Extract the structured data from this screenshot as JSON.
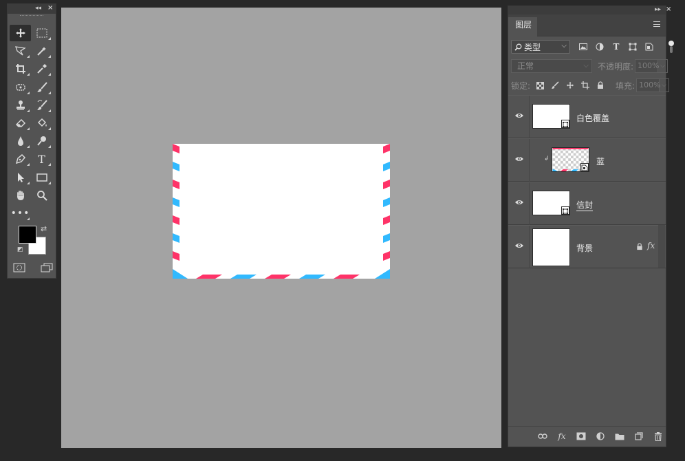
{
  "tools": {
    "rows": [
      [
        "move-tool",
        "marquee-tool"
      ],
      [
        "lasso-tool",
        "quick-select-tool"
      ],
      [
        "crop-tool",
        "eyedropper-tool"
      ],
      [
        "healing-brush-tool",
        "brush-tool"
      ],
      [
        "clone-stamp-tool",
        "history-brush-tool"
      ],
      [
        "eraser-tool",
        "paint-bucket-tool"
      ],
      [
        "blur-tool",
        "dodge-tool"
      ],
      [
        "pen-tool",
        "type-tool"
      ],
      [
        "path-select-tool",
        "rectangle-tool"
      ],
      [
        "hand-tool",
        "zoom-tool"
      ],
      [
        "more-tools",
        ""
      ]
    ],
    "foreground_color": "#000000",
    "background_color": "#ffffff"
  },
  "layers_panel": {
    "tab_label": "图层",
    "filter": {
      "selected": "类型",
      "icons": [
        "image-filter-icon",
        "adjustment-filter-icon",
        "type-filter-icon",
        "shape-filter-icon",
        "smart-object-filter-icon"
      ]
    },
    "blend_mode": "正常",
    "opacity_label": "不透明度:",
    "opacity_value": "100%",
    "lock_label": "锁定:",
    "fill_label": "填充:",
    "fill_value": "100%",
    "layers": [
      {
        "name": "白色覆盖",
        "visible": true,
        "smart_object": true,
        "clipped": false
      },
      {
        "name": "蓝",
        "visible": true,
        "smart_object": true,
        "clipped": true
      },
      {
        "name": "信封",
        "visible": true,
        "smart_object": true,
        "clipped": false
      },
      {
        "name": "背景",
        "visible": true,
        "locked": true,
        "has_fx": true
      }
    ],
    "bottom_icons": [
      "link-layers-icon",
      "fx-icon",
      "mask-icon",
      "adjustment-layer-icon",
      "group-folder-icon",
      "new-layer-icon",
      "delete-icon"
    ]
  },
  "canvas": {
    "envelope_stripe_colors": [
      "#fe3368",
      "#31b9fe"
    ],
    "document_bg": "#a3a3a3"
  }
}
